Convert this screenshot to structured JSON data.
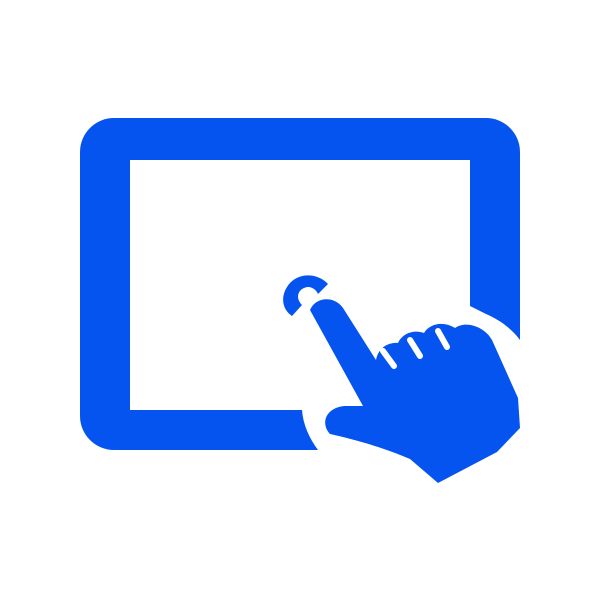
{
  "icon": {
    "name": "touchscreen-tap-icon",
    "components": [
      "tablet-screen-icon",
      "pointing-hand-icon",
      "tap-ripple-icon"
    ]
  },
  "colors": {
    "primary": "#0654EF",
    "background": "#FFFFFF"
  }
}
